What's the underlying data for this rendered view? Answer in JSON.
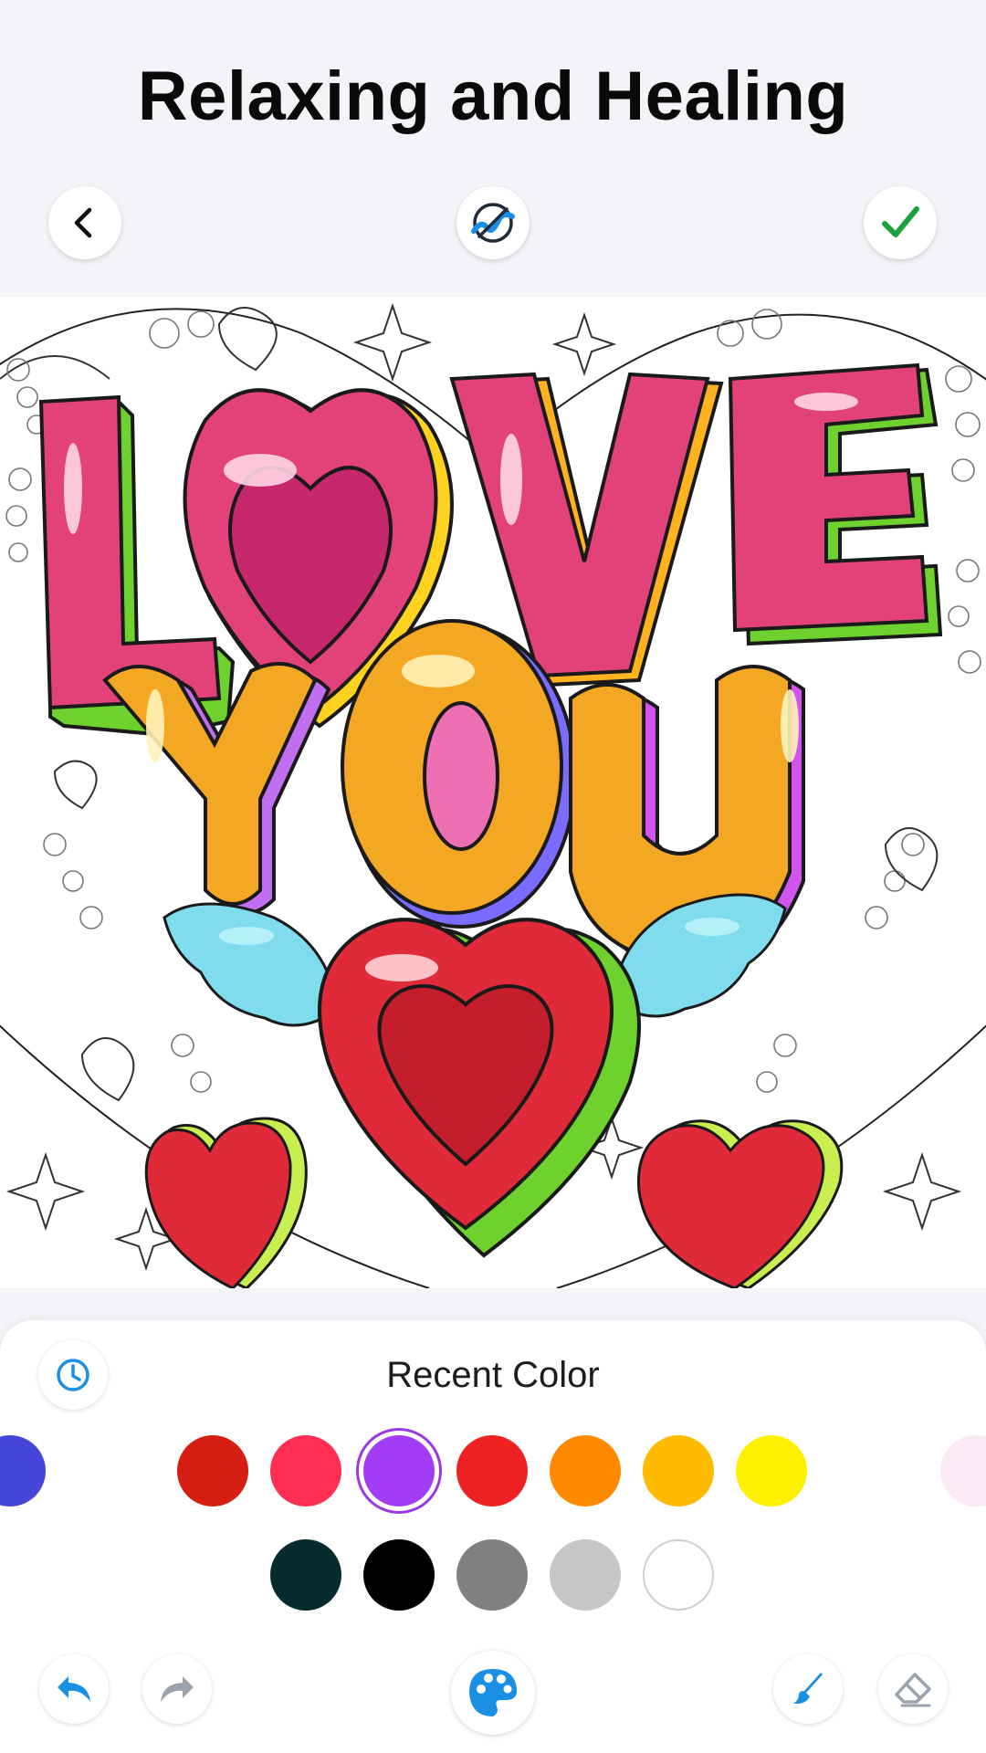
{
  "header": {
    "title": "Relaxing and Healing"
  },
  "toolbar": {
    "back_icon": "chevron-left-icon",
    "hint_icon": "magic-wand-icon",
    "done_icon": "checkmark-icon",
    "done_color": "#1aa33a"
  },
  "artwork": {
    "line1": "LOVE",
    "line2": "YOU",
    "colors": {
      "love": "#e2417a",
      "love_dark": "#c7276b",
      "you": "#f4a723",
      "heart": "#e02a3a",
      "wing": "#7fdcec"
    }
  },
  "panel": {
    "title": "Recent Color",
    "history_icon": "clock-icon"
  },
  "colors_row1": [
    "#4545d8",
    "#d61f12",
    "#ff2e52",
    "#a23cf5",
    "#ee2222",
    "#ff8a00",
    "#ffbb00",
    "#fff000",
    "#fde8f6"
  ],
  "colors_row2": [
    "#062a2e",
    "#000000",
    "#808080",
    "#c6c6c6",
    "#ffffff"
  ],
  "selected_color": "#a23cf5",
  "bottom_tools": {
    "undo_icon": "undo-icon",
    "redo_icon": "redo-icon",
    "palette_icon": "palette-icon",
    "brush_icon": "brush-icon",
    "eraser_icon": "eraser-icon",
    "accent": "#1a8fe3"
  }
}
